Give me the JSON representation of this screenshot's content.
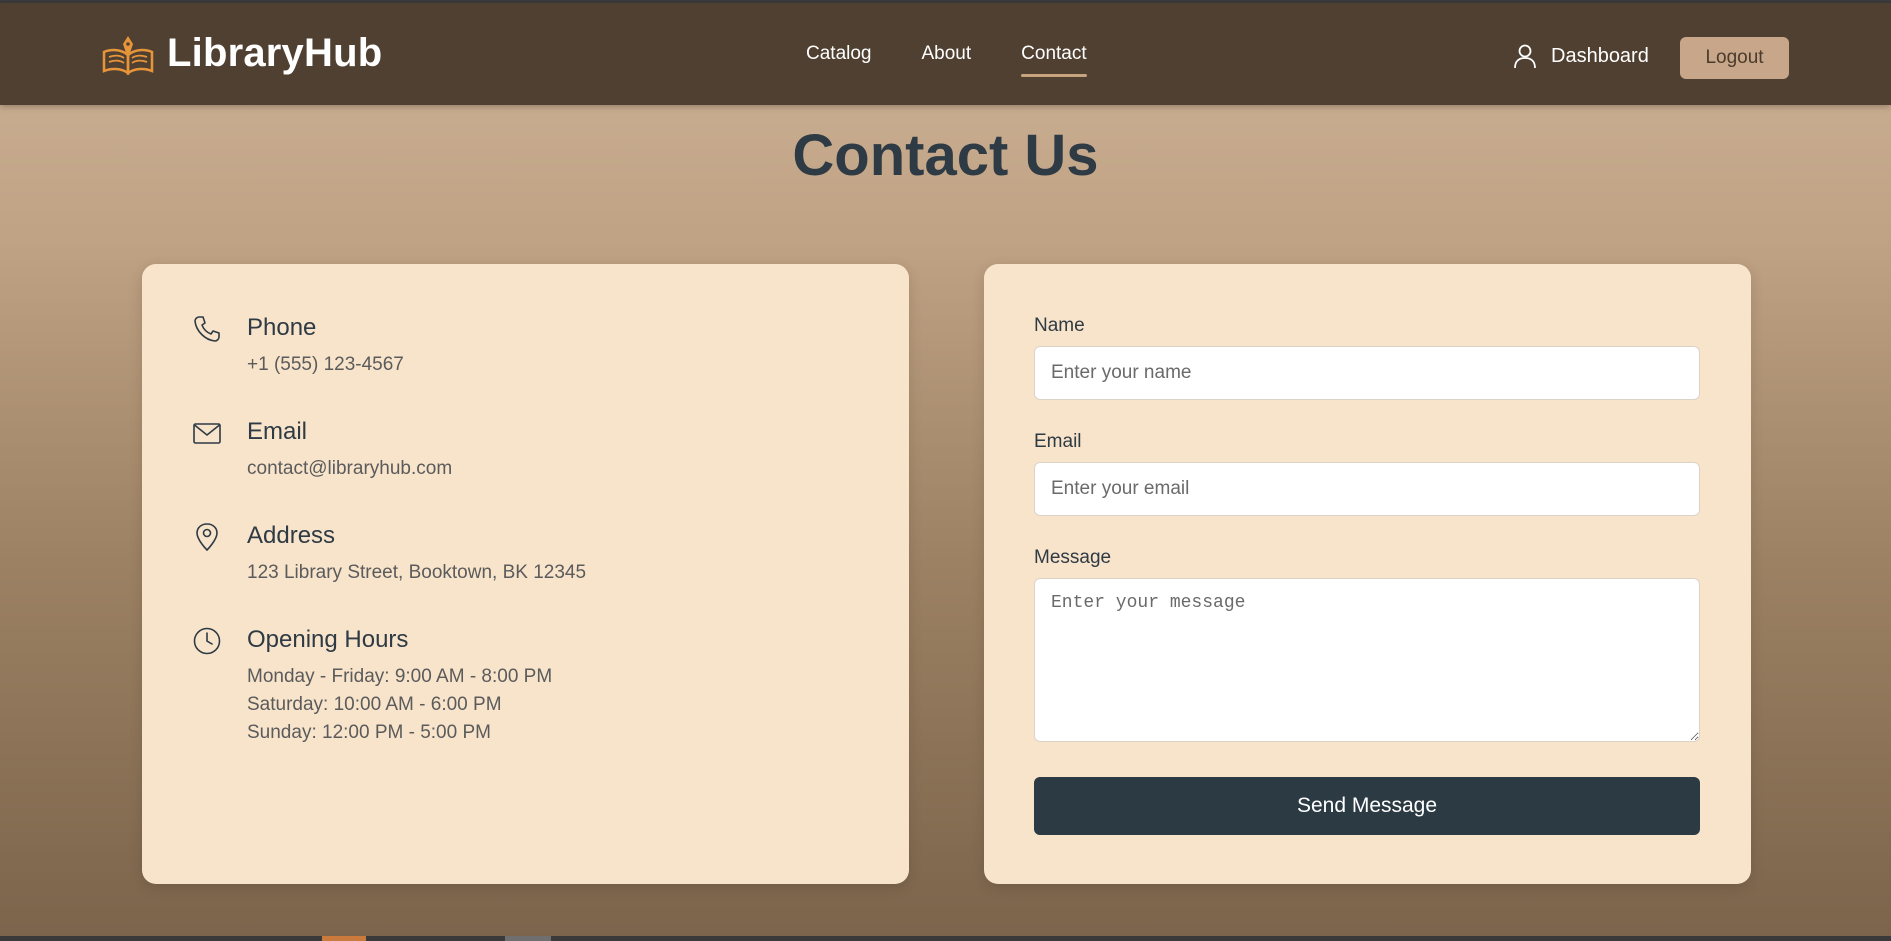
{
  "header": {
    "brand": "LibraryHub",
    "nav": [
      {
        "label": "Catalog"
      },
      {
        "label": "About"
      },
      {
        "label": "Contact",
        "active": true
      }
    ],
    "dashboard_label": "Dashboard",
    "logout_label": "Logout"
  },
  "page": {
    "title": "Contact Us"
  },
  "contact_info": {
    "phone": {
      "icon": "phone-icon",
      "title": "Phone",
      "value": "+1 (555) 123-4567"
    },
    "email": {
      "icon": "mail-icon",
      "title": "Email",
      "value": "contact@libraryhub.com"
    },
    "address": {
      "icon": "map-pin-icon",
      "title": "Address",
      "value": "123 Library Street, Booktown, BK 12345"
    },
    "hours": {
      "icon": "clock-icon",
      "title": "Opening Hours",
      "lines": [
        "Monday - Friday: 9:00 AM - 8:00 PM",
        "Saturday: 10:00 AM - 6:00 PM",
        "Sunday: 12:00 PM - 5:00 PM"
      ]
    }
  },
  "form": {
    "name_label": "Name",
    "name_placeholder": "Enter your name",
    "email_label": "Email",
    "email_placeholder": "Enter your email",
    "message_label": "Message",
    "message_placeholder": "Enter your message",
    "submit_label": "Send Message"
  },
  "colors": {
    "navbar": "#4f4031",
    "card": "#f8e4cb",
    "primary_button": "#2c3a44",
    "logout_button": "#c8a68a",
    "title_text": "#2e3a44",
    "active_underline": "#c8a47e"
  }
}
